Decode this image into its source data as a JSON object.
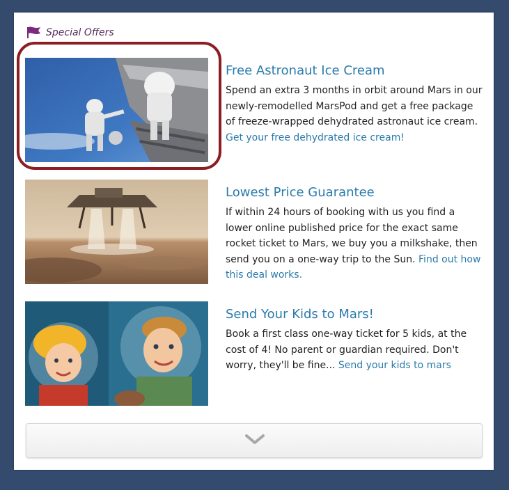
{
  "header": {
    "title": "Special Offers",
    "icon": "flag-icon",
    "icon_color": "#7a2b7e"
  },
  "offers": [
    {
      "title": "Free Astronaut Ice Cream",
      "description": "Spend an extra 3 months in orbit around Mars in our newly-remodelled MarsPod and get a free package of freeze-wrapped dehydrated astronaut ice cream. ",
      "link": "Get your free dehydrated ice cream!",
      "image": "astronauts-spacewalk-photo",
      "highlighted": true
    },
    {
      "title": "Lowest Price Guarantee",
      "description": "If within 24 hours of booking with us you find a lower online published price for the exact same rocket ticket to Mars, we buy you a milkshake, then send you on a one-way trip to the Sun. ",
      "link": "Find out how this deal works.",
      "image": "mars-lander-photo"
    },
    {
      "title": "Send Your Kids to Mars!",
      "description": "Book a first class one-way ticket for 5 kids, at the cost of 4! No parent or guardian required. Don't worry, they'll be fine... ",
      "link": "Send your kids to mars",
      "image": "retro-kids-in-space-helmets-illustration"
    }
  ],
  "more_button": {
    "icon": "chevron-down-icon"
  },
  "colors": {
    "background": "#354b6e",
    "link": "#2a7bab",
    "highlight": "#8c1d22"
  }
}
